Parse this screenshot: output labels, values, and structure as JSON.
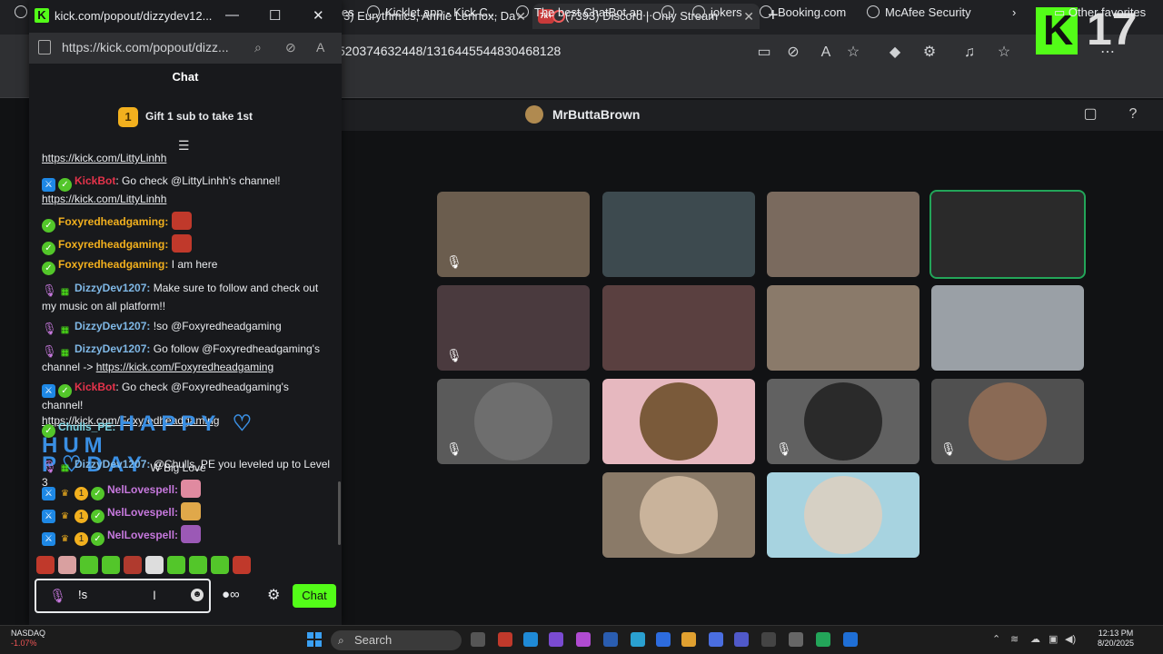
{
  "browser": {
    "tabs": [
      {
        "title": "3) Eurythmics, Annie Lennox, Da"
      },
      {
        "title": "(7393) Discord | Only Stream",
        "badge": "7k+"
      }
    ],
    "address": "520374632448/1316445544830468128",
    "overlay_counter": "17",
    "favorites": [
      "es",
      "Kicklet.app - Kick C...",
      "The best ChatBot an...",
      "jokers",
      "Booking.com",
      "McAfee Security"
    ],
    "other_favorites": "Other favorites"
  },
  "discord": {
    "call_name": "MrButtaBrown",
    "tiles": [
      {
        "color": "#6b5d4e"
      },
      {
        "color": "#3d4a4f"
      },
      {
        "color": "#7a6a5e"
      },
      {
        "color": "#2a2a2a"
      },
      {
        "color": "#4a3a3e"
      },
      {
        "color": "#5a4040"
      },
      {
        "color": "#8a7a6a"
      },
      {
        "color": "#9aa0a6"
      },
      {
        "color": "#5a5a5a"
      },
      {
        "color": "#e6b8bf"
      },
      {
        "color": "#616161"
      },
      {
        "color": "#505050"
      },
      {
        "color": "#8a7a68"
      },
      {
        "color": "#a7d3e0"
      }
    ]
  },
  "popout": {
    "window_title": "kick.com/popout/dizzydev12...",
    "url": "https://kick.com/popout/dizz...",
    "chat_title": "Chat",
    "gift_text": "Gift 1 sub to take 1st",
    "gift_rank": "1",
    "messages": {
      "m0_link": "https://kick.com/LittyLinhh",
      "m1_user": "KickBot",
      "m1_text": "Go check @LittyLinhh's channel!",
      "m1_link": "https://kick.com/LittyLinhh",
      "m2_user": "Foxyredheadgaming:",
      "m3_user": "Foxyredheadgaming:",
      "m4_user": "Foxyredheadgaming:",
      "m4_text": "I am here",
      "m5_user": "DizzyDev1207:",
      "m5_text": "Make sure to follow and check out my music on all platform!!",
      "m6_user": "DizzyDev1207:",
      "m6_text": "!so @Foxyredheadgaming",
      "m7_user": "DizzyDev1207:",
      "m7_text": "Go follow @Foxyredheadgaming's channel ->",
      "m7_link": "https://kick.com/Foxyredheadgaming",
      "m8_user": "KickBot",
      "m8_text": "Go check @Foxyredheadgaming's channel!",
      "m8_link": "https://kick.com/Foxyredheadgaming",
      "m9_user": "Chulls_PE:",
      "m9_big1": "HAPPY ♡ HUM",
      "m9_big2": "P♡DAY",
      "m9_text": "W Big Love",
      "m10_user": "DizzyDev1207:",
      "m10_text": "@Chulls_PE you leveled up to Level 3",
      "m11_user": "NelLovespell:",
      "m12_user": "NelLovespell:",
      "m13_user": "NelLovespell:"
    },
    "input_value": "!s",
    "chat_button": "Chat",
    "colors": {
      "kick_green": "#53fc18",
      "kickbot": "#e5334b",
      "foxy": "#f2b01e",
      "dizzy": "#7fb8e6",
      "chulls": "#7ad2e0",
      "nel": "#c678dd"
    }
  },
  "taskbar": {
    "stock_name": "NASDAQ",
    "stock_change": "-1.07%",
    "search": "Search",
    "time": "12:13 PM",
    "date": "8/20/2025"
  }
}
